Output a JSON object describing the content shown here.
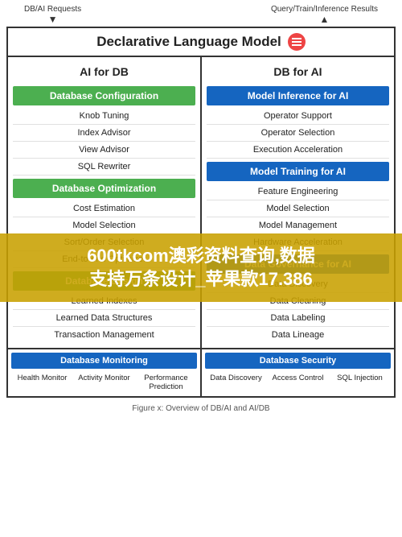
{
  "topArrows": {
    "left": {
      "label": "DB/AI Requests",
      "direction": "down"
    },
    "right": {
      "label": "Query/Train/Inference Results",
      "direction": "up"
    }
  },
  "dlm": {
    "title": "Declarative Language Model"
  },
  "aiForDb": {
    "header": "AI for DB",
    "sections": [
      {
        "title": "Database Configuration",
        "type": "green",
        "items": [
          "Knob Tuning",
          "Index Advisor",
          "View Advisor",
          "SQL Rewriter"
        ]
      },
      {
        "title": "Database Optimization",
        "type": "green",
        "items": [
          "Cost Estimation",
          "Model Selection",
          "Sort/Order Selection",
          "End-to-end Optimizer"
        ]
      },
      {
        "title": "Database Design",
        "type": "green",
        "items": [
          "Learned Indexes",
          "Learned Data Structures",
          "Transaction Management"
        ]
      }
    ]
  },
  "dbForAi": {
    "header": "DB for AI",
    "sections": [
      {
        "title": "Model Inference for AI",
        "type": "blue",
        "items": [
          "Operator Support",
          "Operator Selection",
          "Execution Acceleration"
        ]
      },
      {
        "title": "Model Training for AI",
        "type": "blue",
        "items": [
          "Feature Engineering",
          "Model Selection",
          "Model Management",
          "Hardware Acceleration"
        ]
      },
      {
        "title": "Data Governance for AI",
        "type": "blue",
        "items": [
          "Data Discovery",
          "Data Cleaning",
          "Data Labeling",
          "Data Lineage"
        ]
      }
    ]
  },
  "bottomLeft": {
    "header": "Database Monitoring",
    "items": [
      "Health Monitor",
      "Activity Monitor",
      "Performance Prediction"
    ]
  },
  "bottomRight": {
    "header": "Database Security",
    "items": [
      "Data Discovery",
      "Access Control",
      "SQL Injection"
    ]
  },
  "watermark": {
    "line1": "600tkcom澳彩资料查询,数据",
    "line2": "支持万条设计_苹果款17.386"
  },
  "figureCaption": "Figure x: Overview of DB/AI and AI/DB"
}
